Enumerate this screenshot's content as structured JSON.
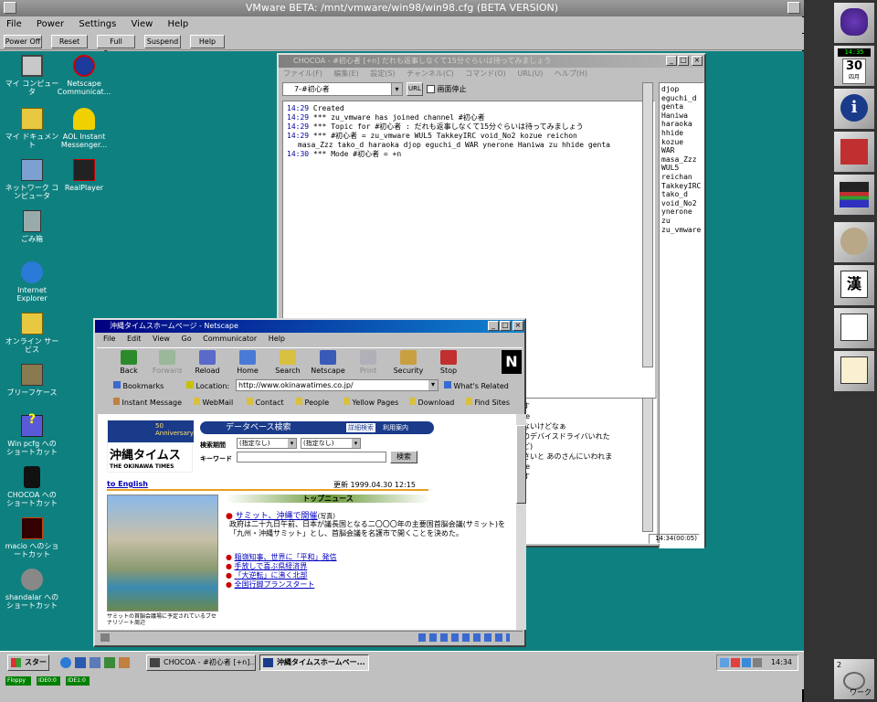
{
  "vmware": {
    "title": "VMware BETA: /mnt/vmware/win98/win98.cfg (BETA VERSION)",
    "menu": [
      "File",
      "Power",
      "Settings",
      "View",
      "Help"
    ],
    "buttons": [
      "Power Off",
      "Reset",
      "Full Screen",
      "Suspend",
      "Help"
    ],
    "status": [
      "Floppy",
      "IDE0:0",
      "IDE1:0"
    ]
  },
  "desktop": {
    "icons": [
      {
        "name": "mycomputer",
        "label": "マイ コンピュータ",
        "icon": "computer-icon"
      },
      {
        "name": "netscape-communicator",
        "label": "Netscape Communicat...",
        "icon": "netscape-icon"
      },
      {
        "name": "mydocuments",
        "label": "マイ ドキュメント",
        "icon": "folder-icon"
      },
      {
        "name": "aim",
        "label": "AOL Instant Messenger...",
        "icon": "aim-icon"
      },
      {
        "name": "network",
        "label": "ネットワーク コンピュータ",
        "icon": "network-icon"
      },
      {
        "name": "realplayer",
        "label": "RealPlayer",
        "icon": "realplayer-icon"
      },
      {
        "name": "recycle",
        "label": "ごみ箱",
        "icon": "recycle-bin-icon"
      },
      {
        "name": "ie",
        "label": "Internet Explorer",
        "icon": "ie-icon"
      },
      {
        "name": "online",
        "label": "オンライン サービス",
        "icon": "folder-icon"
      },
      {
        "name": "briefcase",
        "label": "ブリーフケース",
        "icon": "briefcase-icon"
      },
      {
        "name": "winpcfg",
        "label": "Win pcfg への ショートカット",
        "icon": "help-icon"
      },
      {
        "name": "chocoa-shortcut",
        "label": "CHOCOA への ショートカット",
        "icon": "chocoa-icon"
      },
      {
        "name": "macio",
        "label": "macio へのショ ートカット",
        "icon": "macio-icon"
      },
      {
        "name": "shandalar",
        "label": "shandalar への ショートカット",
        "icon": "skull-icon"
      }
    ]
  },
  "chocoa": {
    "title": "CHOCOA - #初心者 [+n] だれも返事しなくて15分ぐらいは待ってみましょう",
    "menu": [
      "ファイル(F)",
      "編集(E)",
      "設定(S)",
      "チャンネル(C)",
      "コマンド(O)",
      "URL(U)",
      "ヘルプ(H)"
    ],
    "channel_select": "7-#初心者",
    "url_button": "URL",
    "pause_label": "画面停止",
    "log": [
      {
        "time": "14:29",
        "text": "Created"
      },
      {
        "time": "14:29",
        "text": "*** zu_vmware has joined channel #初心者"
      },
      {
        "time": "14:29",
        "text": "*** Topic for #初心者 : だれも返事しなくて15分ぐらいは待ってみましょう"
      },
      {
        "time": "14:29",
        "text": "*** #初心者 = zu_vmware WUL5 TakkeyIRC void_No2 kozue reichon"
      },
      {
        "time": "",
        "text": "masa_Zzz tako_d haraoka djop eguchi_d WAR ynerone Haniwa zu hhide genta"
      },
      {
        "time": "14:30",
        "text": "*** Mode #初心者 = +n"
      }
    ],
    "nicks": [
      "djop",
      "eguchi_d",
      "genta",
      "Haniwa",
      "haraoka",
      "hhide",
      "kozue",
      "WAR",
      "masa_Zzz",
      "WUL5",
      "reichan",
      "TakkeyIRC",
      "tako_d",
      "void_No2",
      "ynerone",
      "zu",
      "zu_vmware"
    ],
    "lower_lines": [
      "す",
      "re",
      "",
      "",
      "ないけどなぁ",
      "のデバイスドライバいれた",
      "ど)",
      "さいと あのさんにいわれま",
      "",
      "re",
      "す"
    ],
    "status_time": "14:34(00:05)"
  },
  "netscape": {
    "title": "沖縄タイムスホームページ - Netscape",
    "menu": [
      "File",
      "Edit",
      "View",
      "Go",
      "Communicator",
      "Help"
    ],
    "nav": [
      "Back",
      "Forward",
      "Reload",
      "Home",
      "Search",
      "Netscape",
      "Print",
      "Security",
      "Stop"
    ],
    "bookmarks_label": "Bookmarks",
    "location_label": "Location:",
    "location_value": "http://www.okinawatimes.co.jp/",
    "whats_related": "What's Related",
    "personal": [
      "Instant Message",
      "WebMail",
      "Contact",
      "People",
      "Yellow Pages",
      "Download",
      "Find Sites"
    ],
    "page": {
      "db_search": "データベース検索",
      "detail_search": "詳細検索",
      "usage": "利用案内",
      "period_label": "検索期間",
      "select1": "(指定なし)",
      "select2": "(指定なし)",
      "keyword_label": "キーワード",
      "search_btn": "検索",
      "logo_jp": "沖縄タイムス",
      "logo_en": "THE OKINAWA TIMES",
      "anniversary": "50 Anniversary",
      "to_english": "to English",
      "updated": "更新 1999.04.30 12:15",
      "top_news": "トップニュース",
      "headline": "サミット、沖縄で開催",
      "headline_tag": "(写真)",
      "headline_body": "政府は二十九日午前、日本が議長国となる二〇〇〇年の主要国首脳会議(サミット)を「九州・沖縄サミット」とし、首脳会議を名護市で開くことを決めた。",
      "news": [
        "稲嶺知事、世界に「平和」発信",
        "手放しで喜ぶ県経済界",
        "「大逆転」に沸く北部",
        "全国行脚プランスタート"
      ],
      "caption": "サミットの首脳会議場に予定されているブセナリゾート周辺"
    }
  },
  "taskbar": {
    "start": "スタート",
    "tasks": [
      "CHOCOA - #初心者 [+n]...",
      "沖縄タイムスホームペー..."
    ],
    "clock": "14:34"
  },
  "dock": {
    "clock_day": "30",
    "clock_month": "四月",
    "clock_time": "14:35",
    "workspace_number": "2",
    "workspace_label": "ワーク"
  }
}
